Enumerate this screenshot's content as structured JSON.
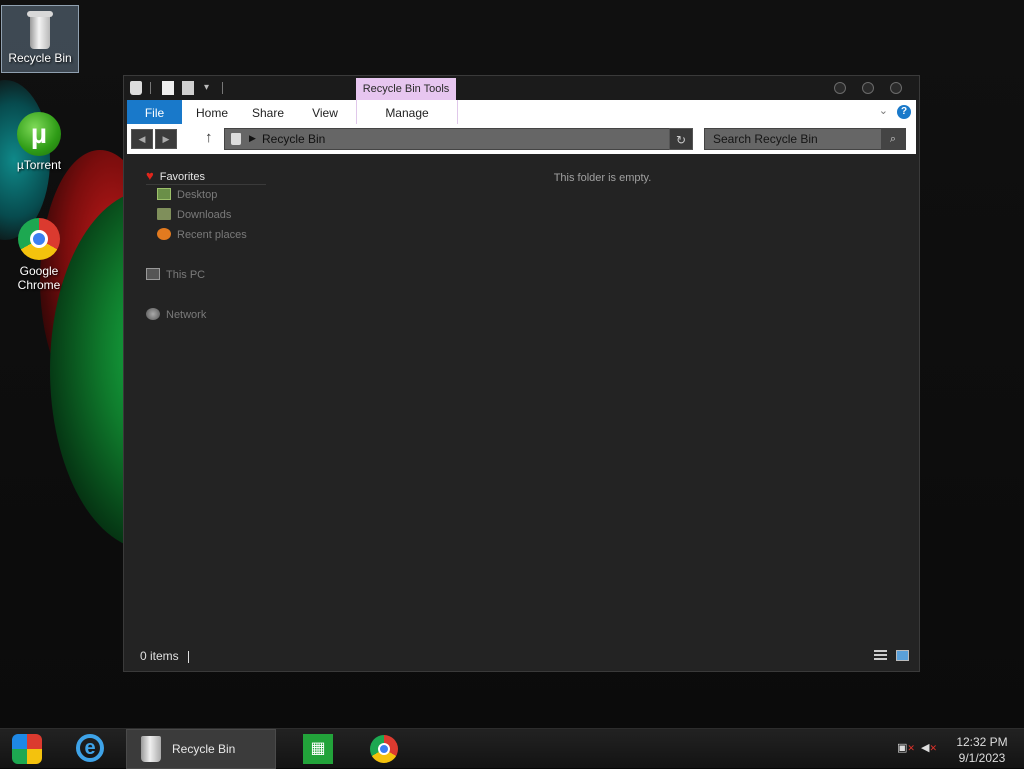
{
  "desktop": {
    "icons": [
      {
        "label": "Recycle Bin",
        "icon": "recycle-bin-icon",
        "selected": true
      },
      {
        "label": "µTorrent",
        "icon": "utorrent-icon"
      },
      {
        "label": "Google Chrome",
        "icon": "chrome-icon"
      }
    ]
  },
  "window": {
    "title_context_tab": "Recycle Bin Tools",
    "ribbon": {
      "tabs": [
        "File",
        "Home",
        "Share",
        "View"
      ],
      "context_tab": "Manage",
      "help_label": "?"
    },
    "address": {
      "path": "Recycle Bin"
    },
    "search": {
      "placeholder": "Search Recycle Bin"
    },
    "nav": {
      "favorites": "Favorites",
      "desktop": "Desktop",
      "downloads": "Downloads",
      "recent": "Recent places",
      "this_pc": "This PC",
      "network": "Network"
    },
    "empty_message": "This folder is empty.",
    "status": {
      "item_count": "0 items"
    }
  },
  "taskbar": {
    "recycle_label": "Recycle Bin",
    "clock_time": "12:32 PM",
    "clock_date": "9/1/2023"
  },
  "colors": {
    "accent": "#1979ca",
    "context_tab": "#e7c6f0",
    "window_bg": "#232323"
  }
}
